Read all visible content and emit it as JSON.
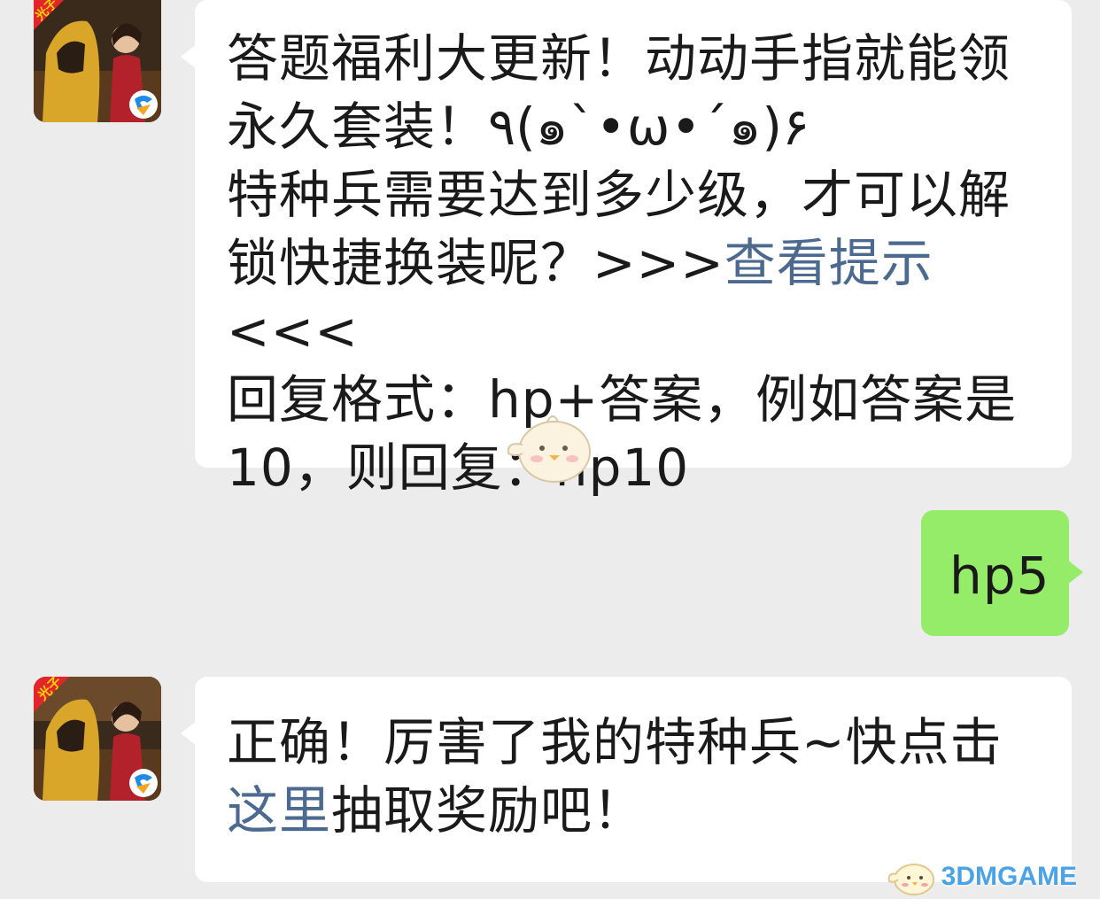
{
  "messages": [
    {
      "sender": "bot",
      "lines": [
        "答题福利大更新！动动手指就能领",
        "永久套装！٩(๑`•ω•´๑)۶",
        "特种兵需要达到多少级，才可以解",
        "锁快捷换装呢？>>>",
        "查看提示",
        "<<<",
        "回复格式：hp+答案，例如答案是",
        "10，则回复：hp10"
      ]
    },
    {
      "sender": "user",
      "text": "hp5"
    },
    {
      "sender": "bot",
      "line1": "正确！厉害了我的特种兵~快点击",
      "link": "这里",
      "line2_rest": "抽取奖励吧！"
    }
  ],
  "avatar_badge": "光子",
  "watermark": "3DMGAME",
  "colors": {
    "background": "#ececec",
    "bot_bubble": "#ffffff",
    "user_bubble": "#95ec69",
    "link": "#4c6a8f",
    "watermark": "#4aa3e6"
  }
}
